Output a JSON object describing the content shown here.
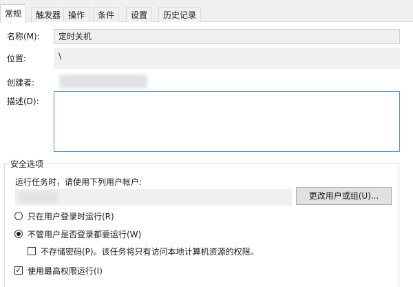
{
  "tabs": [
    {
      "label": "常规"
    },
    {
      "label": "触发器"
    },
    {
      "label": "操作"
    },
    {
      "label": "条件"
    },
    {
      "label": "设置"
    },
    {
      "label": "历史记录"
    }
  ],
  "general": {
    "name_label": "名称(M):",
    "name_value": "定时关机",
    "location_label": "位置:",
    "location_value": "\\",
    "author_label": "创建者:",
    "description_label": "描述(D):"
  },
  "security": {
    "group_title": "安全选项",
    "run_as_text": "运行任务时，请使用下列用户帐户:",
    "change_user_button": "更改用户或组(U)...",
    "option_logged_on": "只在用户登录时运行(R)",
    "option_whether_logged": "不管用户是否登录都要运行(W)",
    "do_not_store_password": "不存储密码(P)。该任务将只有访问本地计算机资源的权限。",
    "highest_privileges": "使用最高权限运行(I)"
  }
}
